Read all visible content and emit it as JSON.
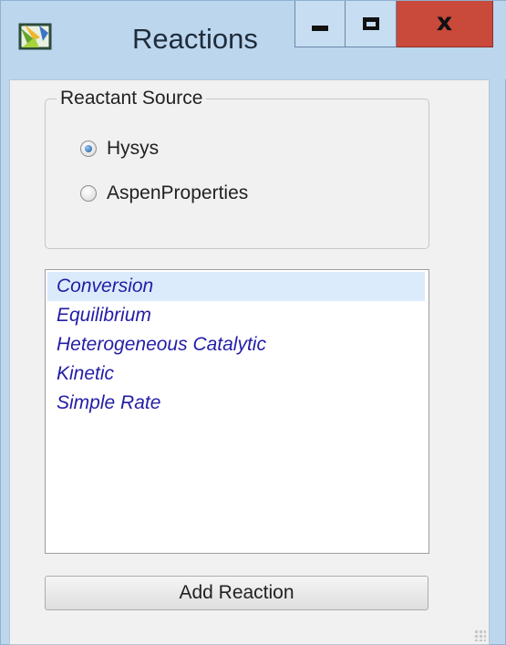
{
  "window": {
    "title": "Reactions",
    "app_icon": "app-icon",
    "controls": {
      "minimize_icon": "minimize-icon",
      "maximize_icon": "maximize-icon",
      "close_glyph": "x"
    }
  },
  "reactant_source": {
    "legend": "Reactant Source",
    "options": [
      {
        "label": "Hysys",
        "selected": true
      },
      {
        "label": "AspenProperties",
        "selected": false
      }
    ]
  },
  "reaction_types": {
    "items": [
      {
        "label": "Conversion",
        "selected": true
      },
      {
        "label": "Equilibrium",
        "selected": false
      },
      {
        "label": "Heterogeneous Catalytic",
        "selected": false
      },
      {
        "label": "Kinetic",
        "selected": false
      },
      {
        "label": "Simple Rate",
        "selected": false
      }
    ]
  },
  "actions": {
    "add_reaction_label": "Add Reaction"
  },
  "colors": {
    "chrome": "#bcd6ee",
    "client_background": "#f1f1f1",
    "close_button": "#c9493b",
    "list_item_text": "#231da6",
    "list_selection": "#dcebfb",
    "radio_selected": "#2c68b0"
  }
}
